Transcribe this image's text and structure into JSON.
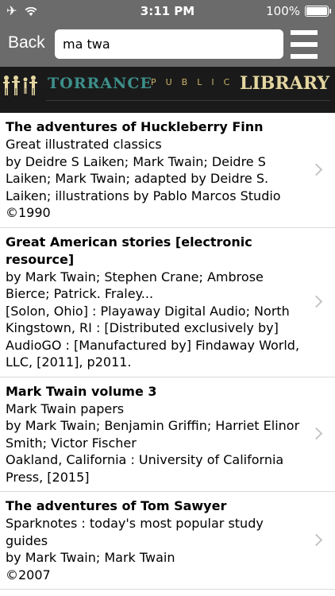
{
  "status": {
    "time": "3:11 PM",
    "battery": "100%"
  },
  "nav": {
    "back_label": "Back",
    "search_value": "ma twa"
  },
  "banner": {
    "torrance": "TORRANCE",
    "public": "PUBLIC",
    "library": "LIBRARY"
  },
  "results": [
    {
      "title": "The adventures of Huckleberry Finn",
      "lines": [
        "Great illustrated classics",
        "by Deidre S Laiken; Mark Twain; Deidre S Laiken; Mark Twain; adapted by Deidre S. Laiken; illustrations by Pablo Marcos Studio",
        "©1990"
      ]
    },
    {
      "title": "Great American stories [electronic resource]",
      "lines": [
        "by Mark Twain; Stephen Crane; Ambrose Bierce; Patrick. Fraley...",
        "[Solon, Ohio] : Playaway Digital Audio; North Kingstown, RI : [Distributed exclusively by] AudioGO : [Manufactured by] Findaway World, LLC, [2011], p2011."
      ]
    },
    {
      "title": "Mark Twain volume 3",
      "lines": [
        "Mark Twain papers",
        "by Mark Twain; Benjamin Griffin; Harriet Elinor Smith; Victor Fischer",
        "Oakland, California : University of California Press, [2015]"
      ]
    },
    {
      "title": "The adventures of Tom Sawyer",
      "lines": [
        "Sparknotes : today's most popular study guides",
        "by Mark Twain; Mark Twain",
        "©2007"
      ]
    }
  ]
}
